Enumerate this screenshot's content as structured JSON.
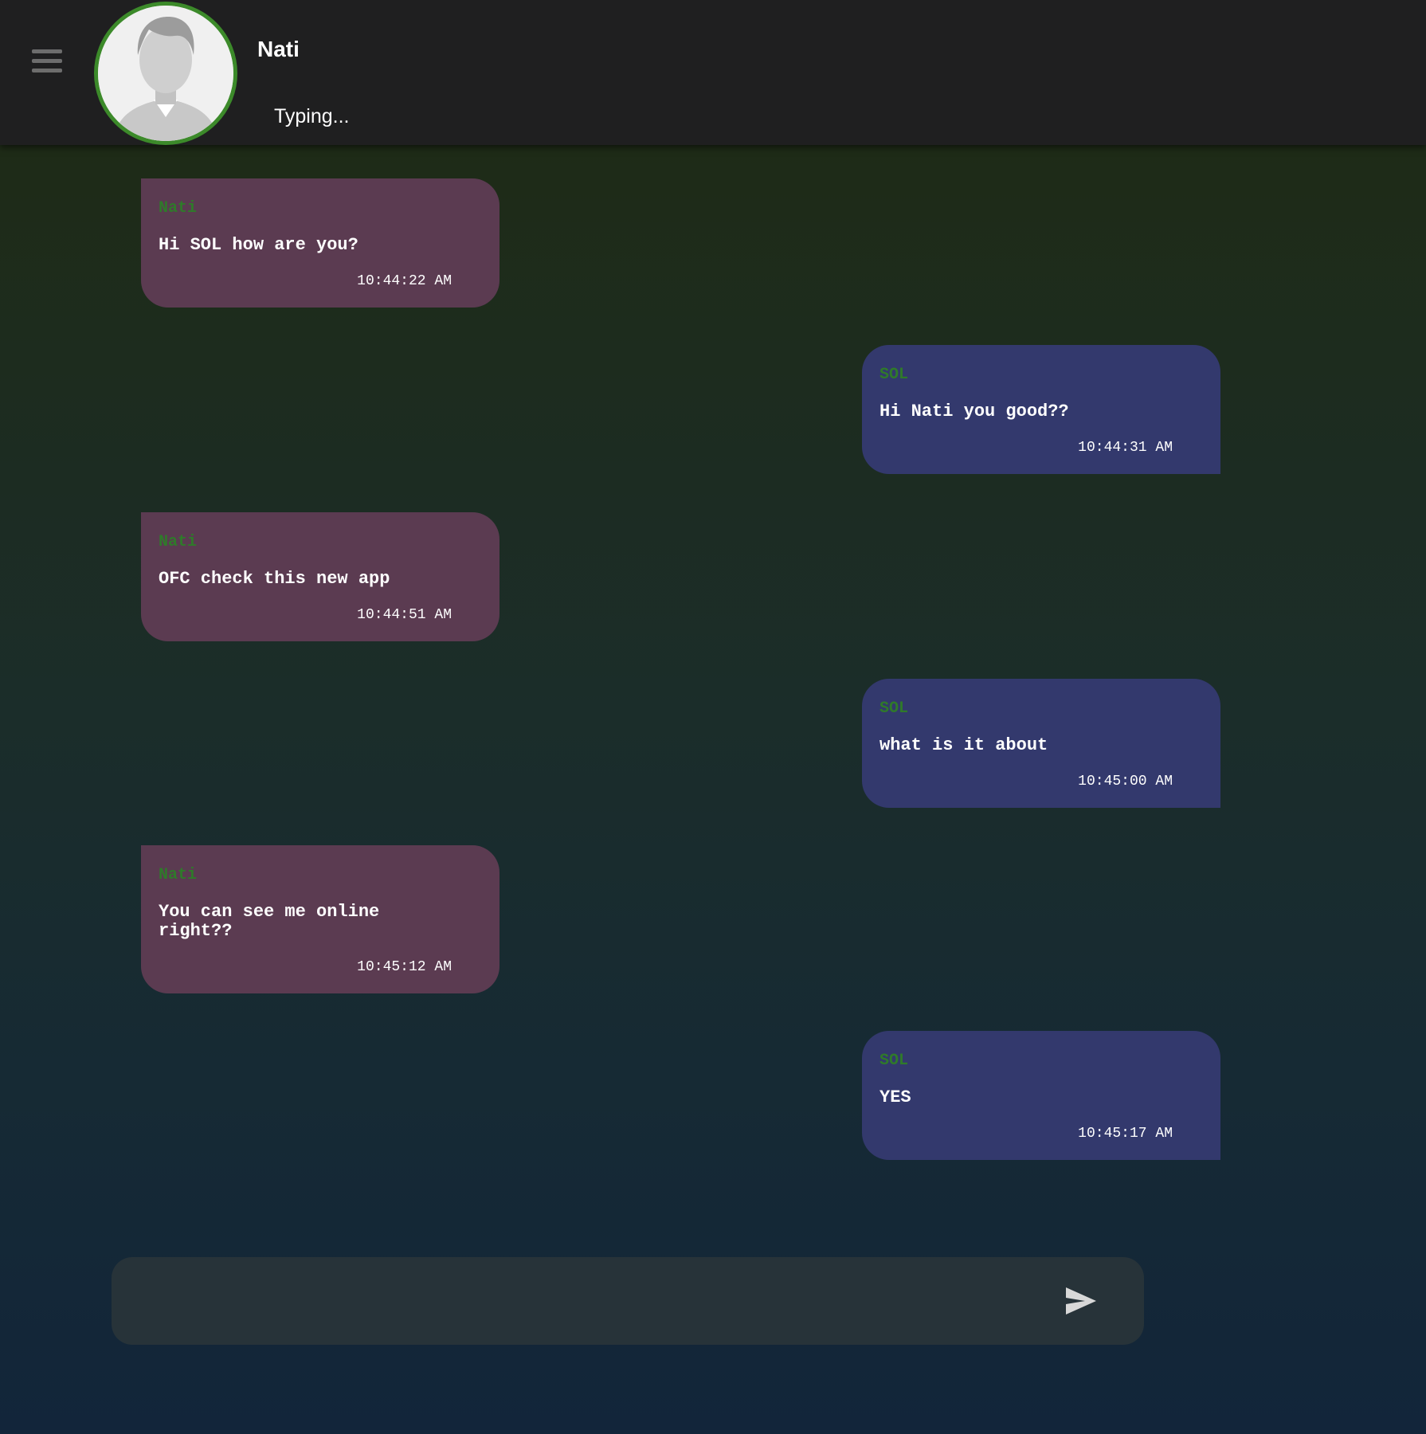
{
  "header": {
    "contact_name": "Nati",
    "status": "Typing..."
  },
  "messages": [
    {
      "direction": "incoming",
      "sender": "Nati",
      "text": "Hi SOL how are you?",
      "time": "10:44:22 AM"
    },
    {
      "direction": "outgoing",
      "sender": "SOL",
      "text": "Hi Nati you good??",
      "time": "10:44:31 AM"
    },
    {
      "direction": "incoming",
      "sender": "Nati",
      "text": "OFC check this new app",
      "time": "10:44:51 AM"
    },
    {
      "direction": "outgoing",
      "sender": "SOL",
      "text": "what is it about",
      "time": "10:45:00 AM"
    },
    {
      "direction": "incoming",
      "sender": "Nati",
      "text": "You can see me online right??",
      "time": "10:45:12 AM"
    },
    {
      "direction": "outgoing",
      "sender": "SOL",
      "text": "YES",
      "time": "10:45:17 AM"
    }
  ],
  "composer": {
    "value": "",
    "placeholder": ""
  },
  "colors": {
    "incoming_bubble": "#5b3b51",
    "outgoing_bubble": "#33396d",
    "sender_name": "#2f7a2a",
    "avatar_ring": "#3c8a2a",
    "header_bg": "#1f1f20"
  },
  "icons": {
    "menu": "hamburger-menu-icon",
    "send": "send-icon",
    "avatar": "user-silhouette-icon"
  }
}
